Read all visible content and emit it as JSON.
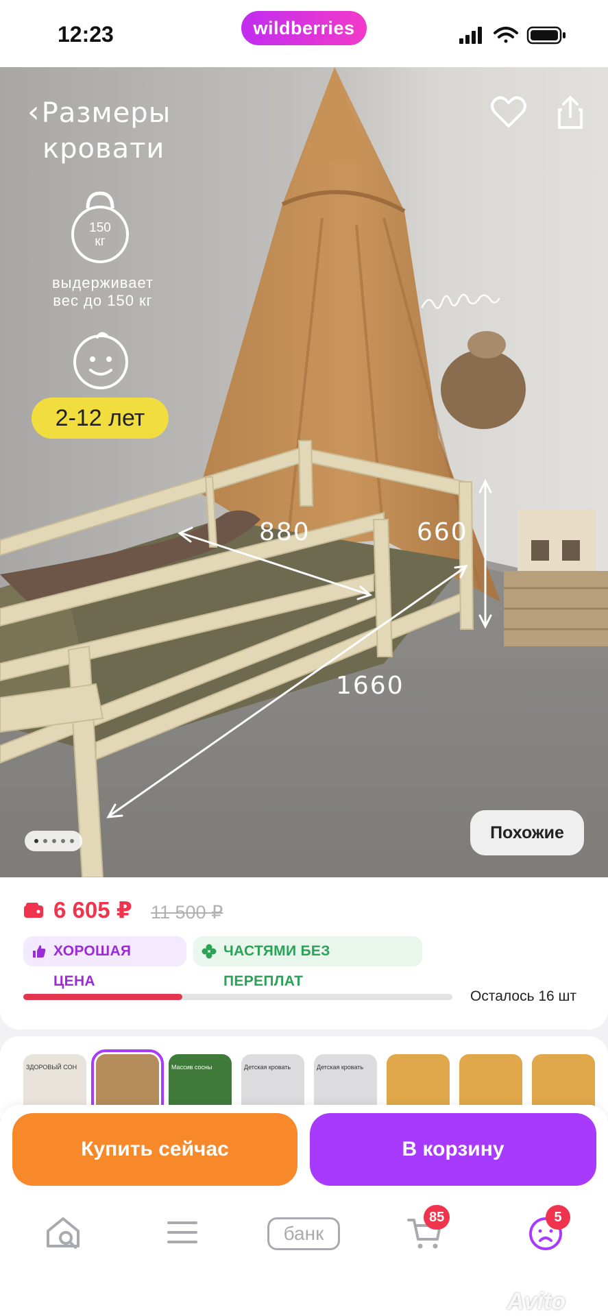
{
  "status_bar": {
    "time": "12:23",
    "app_pill": "wildberries"
  },
  "hero": {
    "title_line1": "Размеры",
    "title_line2": "кровати",
    "weight_value": "150",
    "weight_unit": "кг",
    "weight_caption_line1": "выдерживает",
    "weight_caption_line2": "вес до 150 кг",
    "age_badge": "2-12 лет",
    "dim_width": "880",
    "dim_height": "660",
    "dim_length": "1660",
    "signature": "улыбнись",
    "similar_button": "Похожие",
    "pager": {
      "count": 5,
      "active": 0
    }
  },
  "product": {
    "price": "6 605 ₽",
    "old_price": "11 500 ₽",
    "chip_good_price": "ХОРОШАЯ ЦЕНА",
    "chip_installments": "ЧАСТЯМИ БЕЗ ПЕРЕПЛАТ",
    "stock_text": "Осталось 16 шт",
    "stock_fraction": 0.37
  },
  "thumbnails": [
    {
      "label": "ЗДОРОВЫЙ СОН",
      "style": "light"
    },
    {
      "label": "",
      "style": "photo",
      "selected": true
    },
    {
      "label": "Массив сосны",
      "style": "green"
    },
    {
      "label": "Детская кровать",
      "style": "gray"
    },
    {
      "label": "Детская кровать",
      "style": "gray"
    },
    {
      "label": "",
      "style": "orange"
    },
    {
      "label": "",
      "style": "orange"
    },
    {
      "label": "",
      "style": "orange"
    }
  ],
  "actions": {
    "buy_now": "Купить сейчас",
    "add_to_cart": "В корзину"
  },
  "tab_bar": {
    "bank_label": "банк",
    "cart_badge": "85",
    "profile_badge": "5"
  },
  "watermark": "Avito",
  "colors": {
    "accent_purple": "#a73afd",
    "buy_orange": "#f7892a",
    "price_red": "#f0344e",
    "age_yellow": "#f2dd3f"
  }
}
